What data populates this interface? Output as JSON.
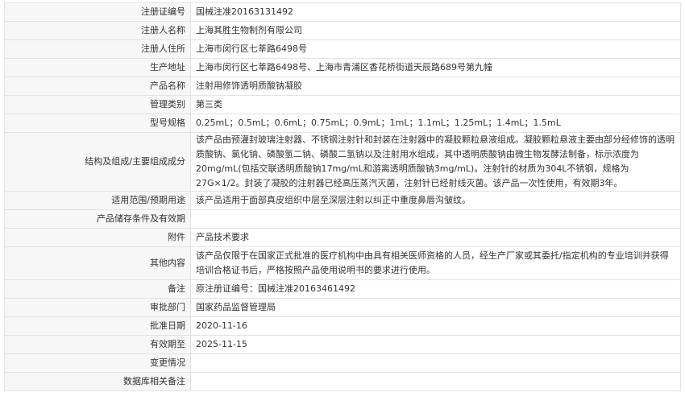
{
  "rows": [
    {
      "label": "注册证编号",
      "value": "国械注准20163131492"
    },
    {
      "label": "注册人名称",
      "value": "上海其胜生物制剂有限公司"
    },
    {
      "label": "注册人住所",
      "value": "上海市闵行区七莘路6498号"
    },
    {
      "label": "生产地址",
      "value": "上海市闵行区七莘路6498号、上海市青浦区香花桥街道天辰路689号第九幢"
    },
    {
      "label": "产品名称",
      "value": "注射用修饰透明质酸钠凝胶"
    },
    {
      "label": "管理类别",
      "value": "第三类"
    },
    {
      "label": "型号规格",
      "value": "0.25mL；0.5mL；0.6mL；0.75mL；0.9mL；1mL；1.1mL；1.25mL；1.4mL；1.5mL"
    },
    {
      "label": "结构及组成/主要组成成分",
      "value": "该产品由预灌封玻璃注射器、不锈钢注射针和封装在注射器中的凝胶颗粒悬液组成。凝胶颗粒悬液主要由部分经修饰的透明质酸钠、氯化钠、磷酸氢二钠、磷酸二氢钠以及注射用水组成，其中透明质酸钠由微生物发酵法制备，标示浓度为20mg/mL(包括交联透明质酸钠17mg/mL和游离透明质酸钠3mg/mL)。注射针的材质为304L不锈钢，规格为27G×1/2。封装了凝胶的注射器已经高压蒸汽灭菌，注射针已经射线灭菌。该产品一次性使用，有效期3年。"
    },
    {
      "label": "适用范围/预期用途",
      "value": "该产品适用于面部真皮组织中层至深层注射以纠正中重度鼻唇沟皱纹。"
    },
    {
      "label": "产品储存条件及有效期",
      "value": ""
    },
    {
      "label": "附件",
      "value": "产品技术要求"
    },
    {
      "label": "其他内容",
      "value": "该产品仅限于在国家正式批准的医疗机构中由具有相关医师资格的人员，经生产厂家或其委托/指定机构的专业培训并获得培训合格证书后，严格按照产品使用说明书的要求进行使用。"
    },
    {
      "label": "备注",
      "value": "原注册证编号：国械注准20163461492"
    },
    {
      "label": "审批部门",
      "value": "国家药品监督管理局"
    },
    {
      "label": "批准日期",
      "value": "2020-11-16"
    },
    {
      "label": "有效期至",
      "value": "2025-11-15"
    },
    {
      "label": "变更情况",
      "value": ""
    },
    {
      "label": "数据库相关备注",
      "value": ""
    }
  ]
}
